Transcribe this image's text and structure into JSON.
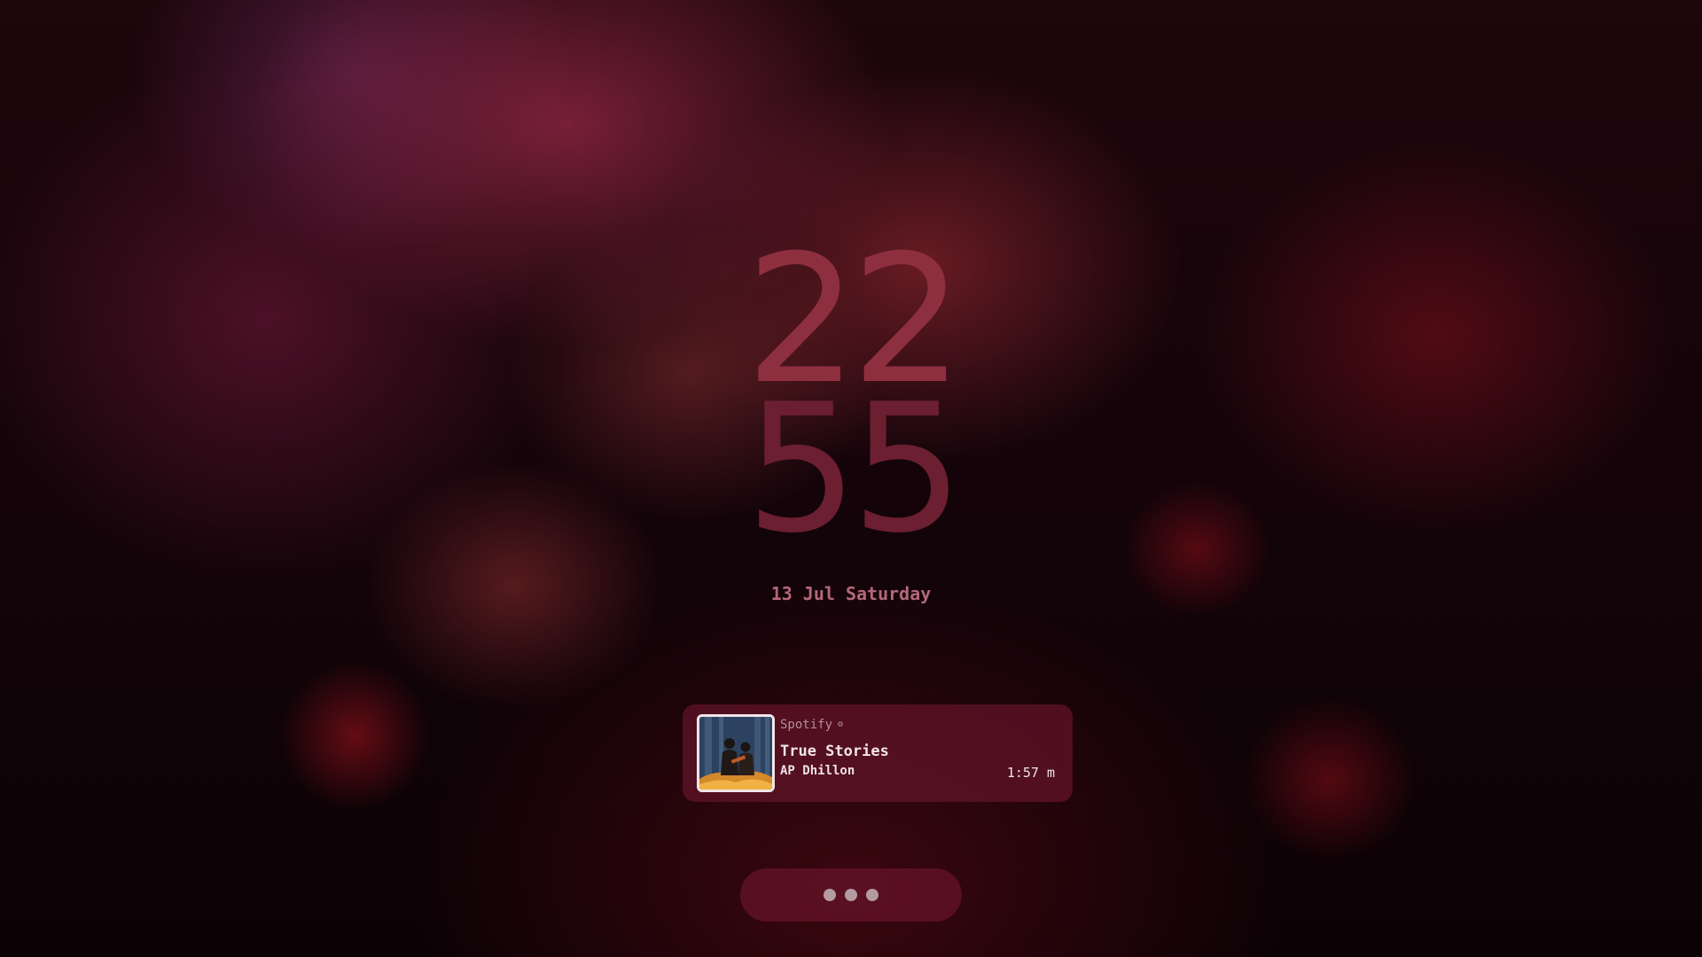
{
  "clock": {
    "hour": "22",
    "minute": "55"
  },
  "date": "13 Jul Saturday",
  "media": {
    "source": "Spotify",
    "source_icon": "⚙",
    "title": "True Stories",
    "artist": "AP Dhillon",
    "time": "1:57 m"
  },
  "colors": {
    "hour": "#8e2f40",
    "minute": "#6c1f30",
    "date": "#b4677a",
    "card_background": "#5c1224"
  }
}
